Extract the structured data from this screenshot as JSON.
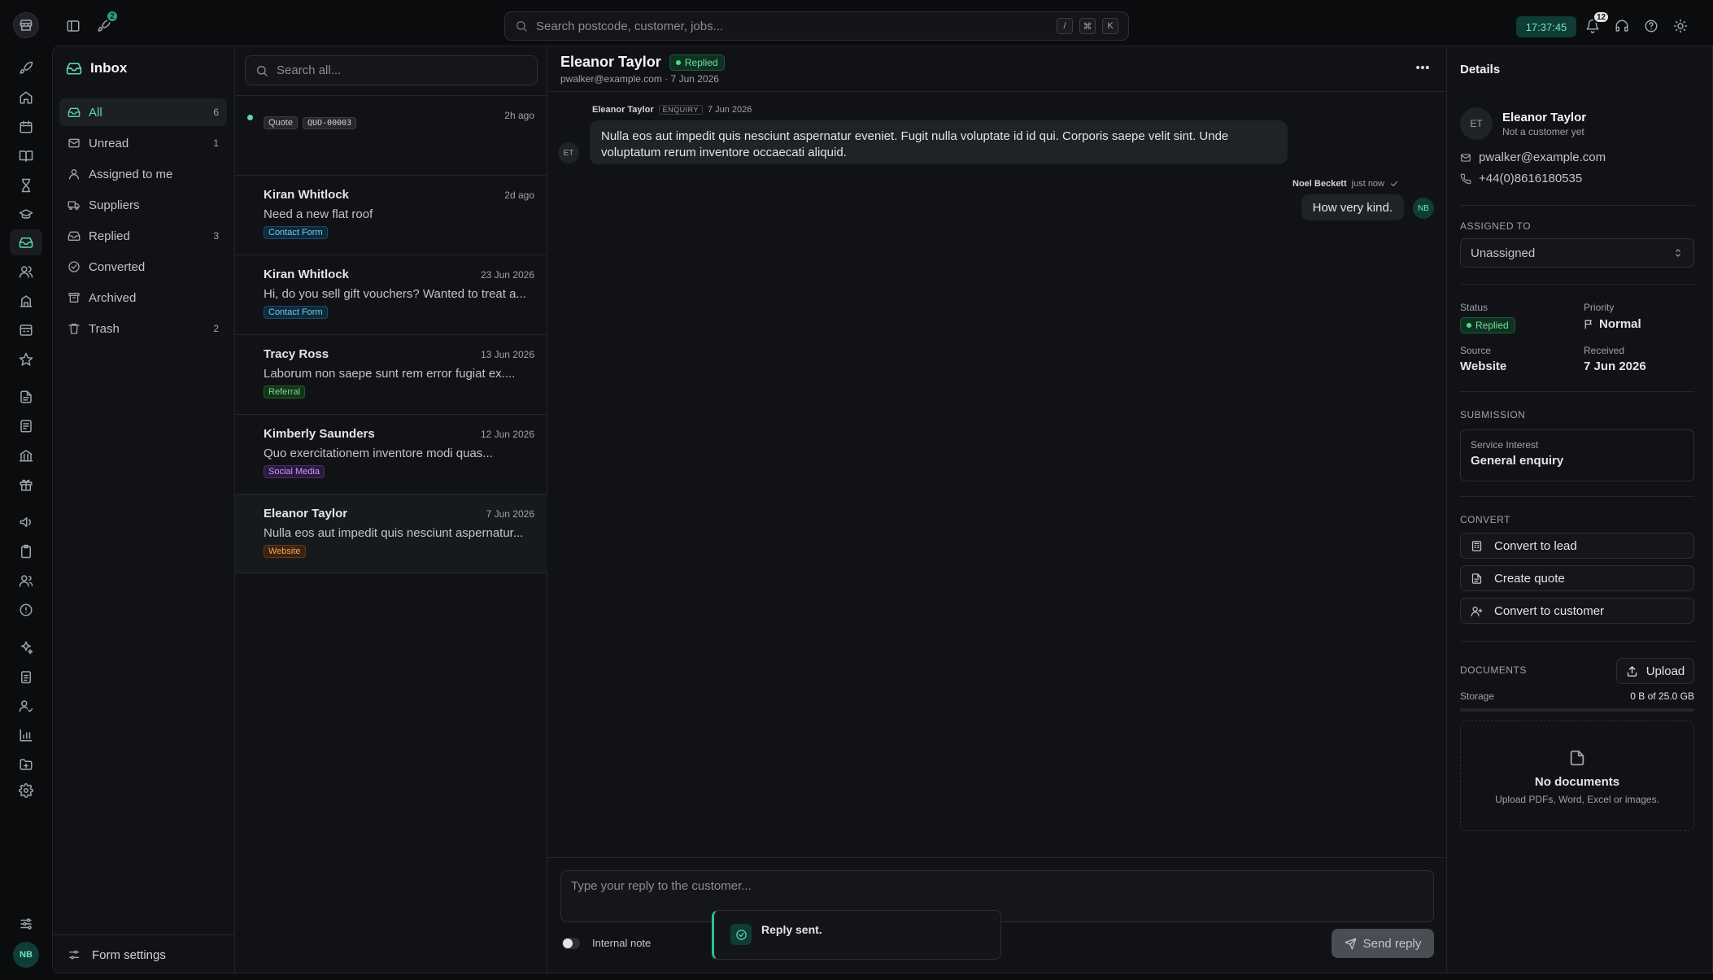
{
  "topbar": {
    "rocket_badge": "2",
    "search_placeholder": "Search postcode, customer, jobs...",
    "search_keys": [
      "/",
      "⌘",
      "K"
    ],
    "clock": "17:37:45",
    "notifications_badge": "12"
  },
  "rail": {
    "icons": [
      "rocket-icon",
      "home-icon",
      "calendar-icon",
      "book-icon",
      "hourglass-icon",
      "graduation-cap-icon",
      "inbox-icon",
      "users-icon",
      "building-icon",
      "calculator-icon",
      "star-icon",
      "file-icon",
      "receipt-icon",
      "bank-icon",
      "gift-icon",
      "megaphone-icon",
      "clipboard-icon",
      "team-icon",
      "alert-circle-icon",
      "sparkle-icon",
      "clipboard-list-icon",
      "user-check-icon",
      "bar-chart-icon",
      "folder-icon",
      "settings-icon"
    ],
    "active_icon": "inbox-icon",
    "user_initials": "NB"
  },
  "inbox": {
    "title": "Inbox",
    "nav": [
      {
        "label": "All",
        "count": "6",
        "icon": "inbox-icon",
        "active": true
      },
      {
        "label": "Unread",
        "count": "1",
        "icon": "mail-icon"
      },
      {
        "label": "Assigned to me",
        "count": "",
        "icon": "user-icon"
      },
      {
        "label": "Suppliers",
        "count": "",
        "icon": "truck-icon"
      },
      {
        "label": "Replied",
        "count": "3",
        "icon": "reply-inbox-icon"
      },
      {
        "label": "Converted",
        "count": "",
        "icon": "check-circle-icon"
      },
      {
        "label": "Archived",
        "count": "",
        "icon": "archive-icon"
      },
      {
        "label": "Trash",
        "count": "2",
        "icon": "trash-icon"
      }
    ],
    "form_settings": "Form settings"
  },
  "list": {
    "search_placeholder": "Search all...",
    "messages": [
      {
        "name": "",
        "date": "2h ago",
        "preview": "",
        "tags": [
          {
            "text": "Quote",
            "kind": "quote"
          },
          {
            "text": "QUO-00003",
            "kind": "code"
          }
        ],
        "unread": true
      },
      {
        "name": "Kiran Whitlock",
        "date": "2d ago",
        "preview": "Need a new flat roof",
        "tags": [
          {
            "text": "Contact Form",
            "kind": "contact"
          }
        ]
      },
      {
        "name": "Kiran Whitlock",
        "date": "23 Jun 2026",
        "preview": "Hi, do you sell gift vouchers? Wanted to treat a...",
        "tags": [
          {
            "text": "Contact Form",
            "kind": "contact"
          }
        ]
      },
      {
        "name": "Tracy Ross",
        "date": "13 Jun 2026",
        "preview": "Laborum non saepe sunt rem error fugiat ex....",
        "tags": [
          {
            "text": "Referral",
            "kind": "referral"
          }
        ]
      },
      {
        "name": "Kimberly Saunders",
        "date": "12 Jun 2026",
        "preview": "Quo exercitationem inventore modi quas...",
        "tags": [
          {
            "text": "Social Media",
            "kind": "social"
          }
        ]
      },
      {
        "name": "Eleanor Taylor",
        "date": "7 Jun 2026",
        "preview": "Nulla eos aut impedit quis nesciunt aspernatur...",
        "tags": [
          {
            "text": "Website",
            "kind": "website"
          }
        ],
        "selected": true
      }
    ]
  },
  "conversation": {
    "name": "Eleanor Taylor",
    "status": "Replied",
    "subline": "pwalker@example.com · 7 Jun 2026",
    "inbound": {
      "author": "Eleanor Taylor",
      "tag": "ENQUIRY",
      "date": "7 Jun 2026",
      "initials": "ET",
      "text": "Nulla eos aut impedit quis nesciunt aspernatur eveniet. Fugit nulla voluptate id id qui. Corporis saepe velit sint. Unde voluptatum rerum inventore occaecati aliquid."
    },
    "outbound": {
      "author": "Noel Beckett",
      "time": "just now",
      "initials": "NB",
      "text": "How very kind."
    },
    "reply_placeholder": "Type your reply to the customer...",
    "internal_note": "Internal note",
    "send_label": "Send reply",
    "toast": "Reply sent."
  },
  "details": {
    "title": "Details",
    "initials": "ET",
    "name": "Eleanor Taylor",
    "subtitle": "Not a customer yet",
    "email": "pwalker@example.com",
    "phone": "+44(0)8616180535",
    "assigned_label": "ASSIGNED TO",
    "assigned_value": "Unassigned",
    "status_label": "Status",
    "status_value": "Replied",
    "priority_label": "Priority",
    "priority_value": "Normal",
    "source_label": "Source",
    "source_value": "Website",
    "received_label": "Received",
    "received_value": "7 Jun 2026",
    "submission_label": "SUBMISSION",
    "service_interest_label": "Service Interest",
    "service_interest_value": "General enquiry",
    "convert_label": "CONVERT",
    "convert_lead": "Convert to lead",
    "create_quote": "Create quote",
    "convert_customer": "Convert to customer",
    "documents_label": "DOCUMENTS",
    "upload_label": "Upload",
    "storage_label": "Storage",
    "storage_value": "0 B of 25.0 GB",
    "storage_fraction": 0,
    "no_docs_title": "No documents",
    "no_docs_sub": "Upload PDFs, Word, Excel or images."
  },
  "colors": {
    "accent": "#5cd6b5",
    "status_green": "#4ade80"
  }
}
